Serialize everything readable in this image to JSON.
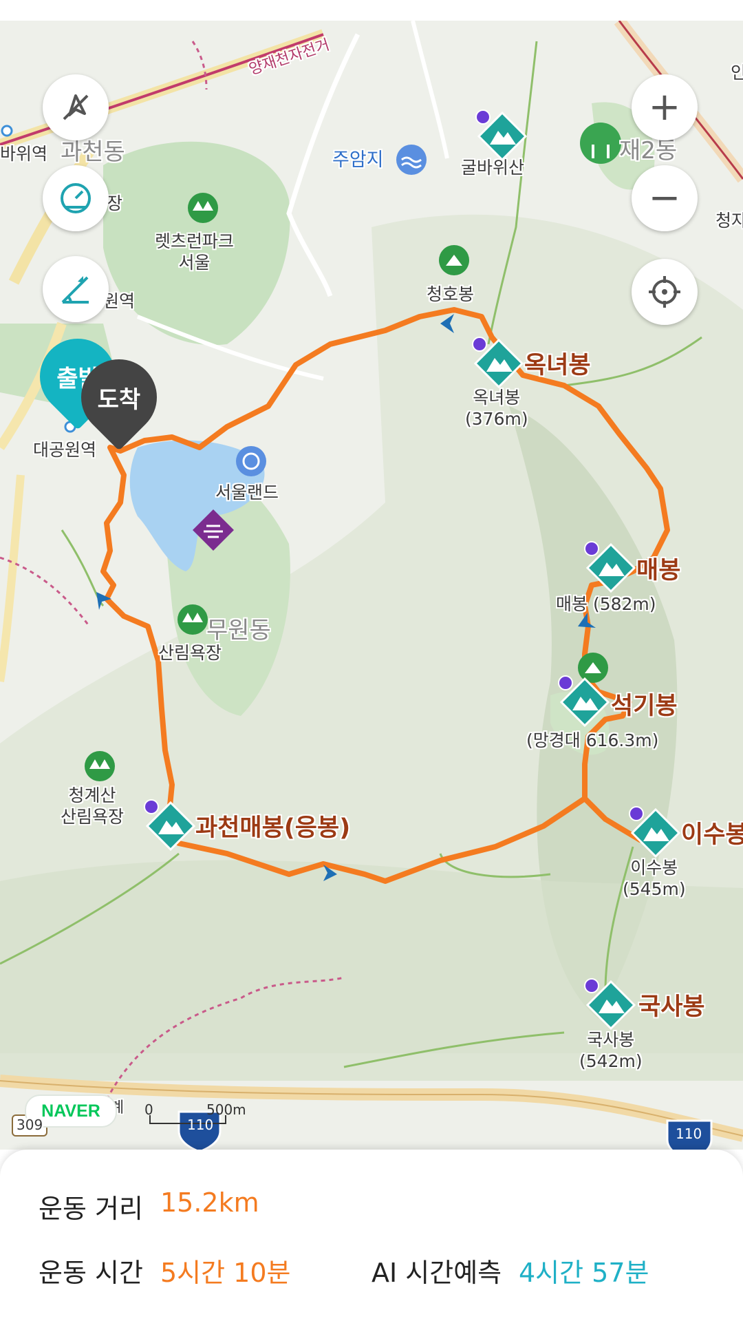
{
  "map": {
    "place_labels": {
      "gwacheon_dong": "과천동",
      "jaeyang_2dong": "재2동",
      "muwon_dong": "무원동",
      "juamji": "주암지",
      "letsrun_park": "렛츠런파크\n서울",
      "seoul_land": "서울랜드",
      "forest_bath_1": "산림욕장",
      "cheonggyesan_forest": "청계산\n산림욕장",
      "daegongwon_station": "대공원역",
      "station_left_1": "바위역",
      "station_left_2": "원역",
      "label_jang": "장",
      "label_cheong": "청자",
      "label_in": "인",
      "road_label": "양재천자전거",
      "naver": "NAVER",
      "scale_zero": "0",
      "scale_text": "500m",
      "road_110_a": "110",
      "road_110_b": "110",
      "road_309": "309",
      "road_gye": "계"
    },
    "peaks": {
      "gulbawisan": "굴바위산",
      "cheonghobong": "청호봉",
      "oknyeobong_title": "옥녀봉",
      "oknyeobong_sub": "옥녀봉\n(376m)",
      "maebong_title": "매봉",
      "maebong_sub": "매봉 (582m)",
      "seokgibong_title": "석기봉",
      "seokgibong_sub": "(망경대 616.3m)",
      "isubong_title": "이수봉",
      "isubong_sub": "이수봉\n(545m)",
      "guksabong_title": "국사봉",
      "guksabong_sub": "국사봉\n(542m)",
      "gwacheon_maebong_title": "과천매봉(응봉)"
    },
    "pins": {
      "start": "출발",
      "arrival": "도착"
    },
    "colors": {
      "route": "#f47b20",
      "peak_marker": "#1fa39a",
      "start_pin": "#14b4c2",
      "arrival_pin": "#444444"
    }
  },
  "controls": {
    "zoom_in": "+",
    "zoom_out": "−"
  },
  "stats": {
    "distance_label": "운동 거리",
    "distance_value": "15.2km",
    "time_label": "운동 시간",
    "time_value": "5시간 10분",
    "ai_label": "AI 시간예측",
    "ai_value": "4시간 57분",
    "colors": {
      "orange": "#f47b20",
      "teal": "#1fb0c6"
    }
  }
}
